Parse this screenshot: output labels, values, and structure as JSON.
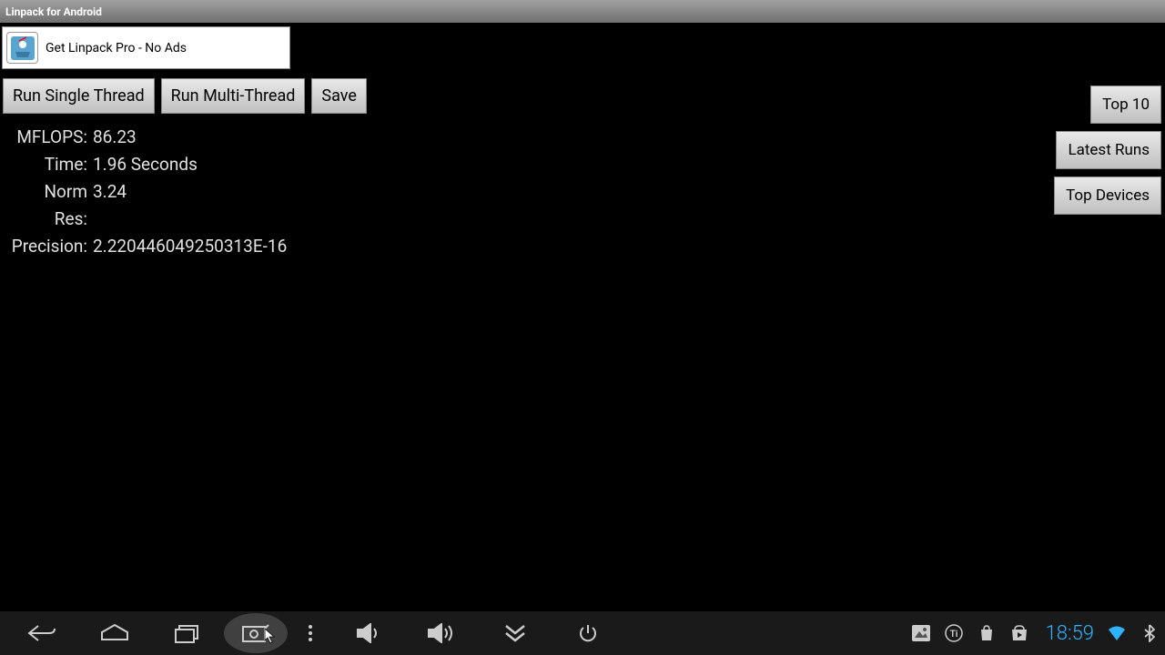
{
  "title_bar": "Linpack for Android",
  "ad": {
    "text": "Get Linpack Pro - No Ads"
  },
  "buttons": {
    "run_single": "Run Single Thread",
    "run_multi": "Run Multi-Thread",
    "save": "Save",
    "top10": "Top 10",
    "latest": "Latest Runs",
    "devices": "Top Devices"
  },
  "results": {
    "mflops_label": "MFLOPS:",
    "mflops_value": "86.23",
    "time_label": "Time:",
    "time_value": "1.96   Seconds",
    "normres_label": "Norm Res:",
    "normres_value": "3.24",
    "precision_label": "Precision:",
    "precision_value": "2.220446049250313E-16"
  },
  "navbar": {
    "clock": "18:59"
  }
}
